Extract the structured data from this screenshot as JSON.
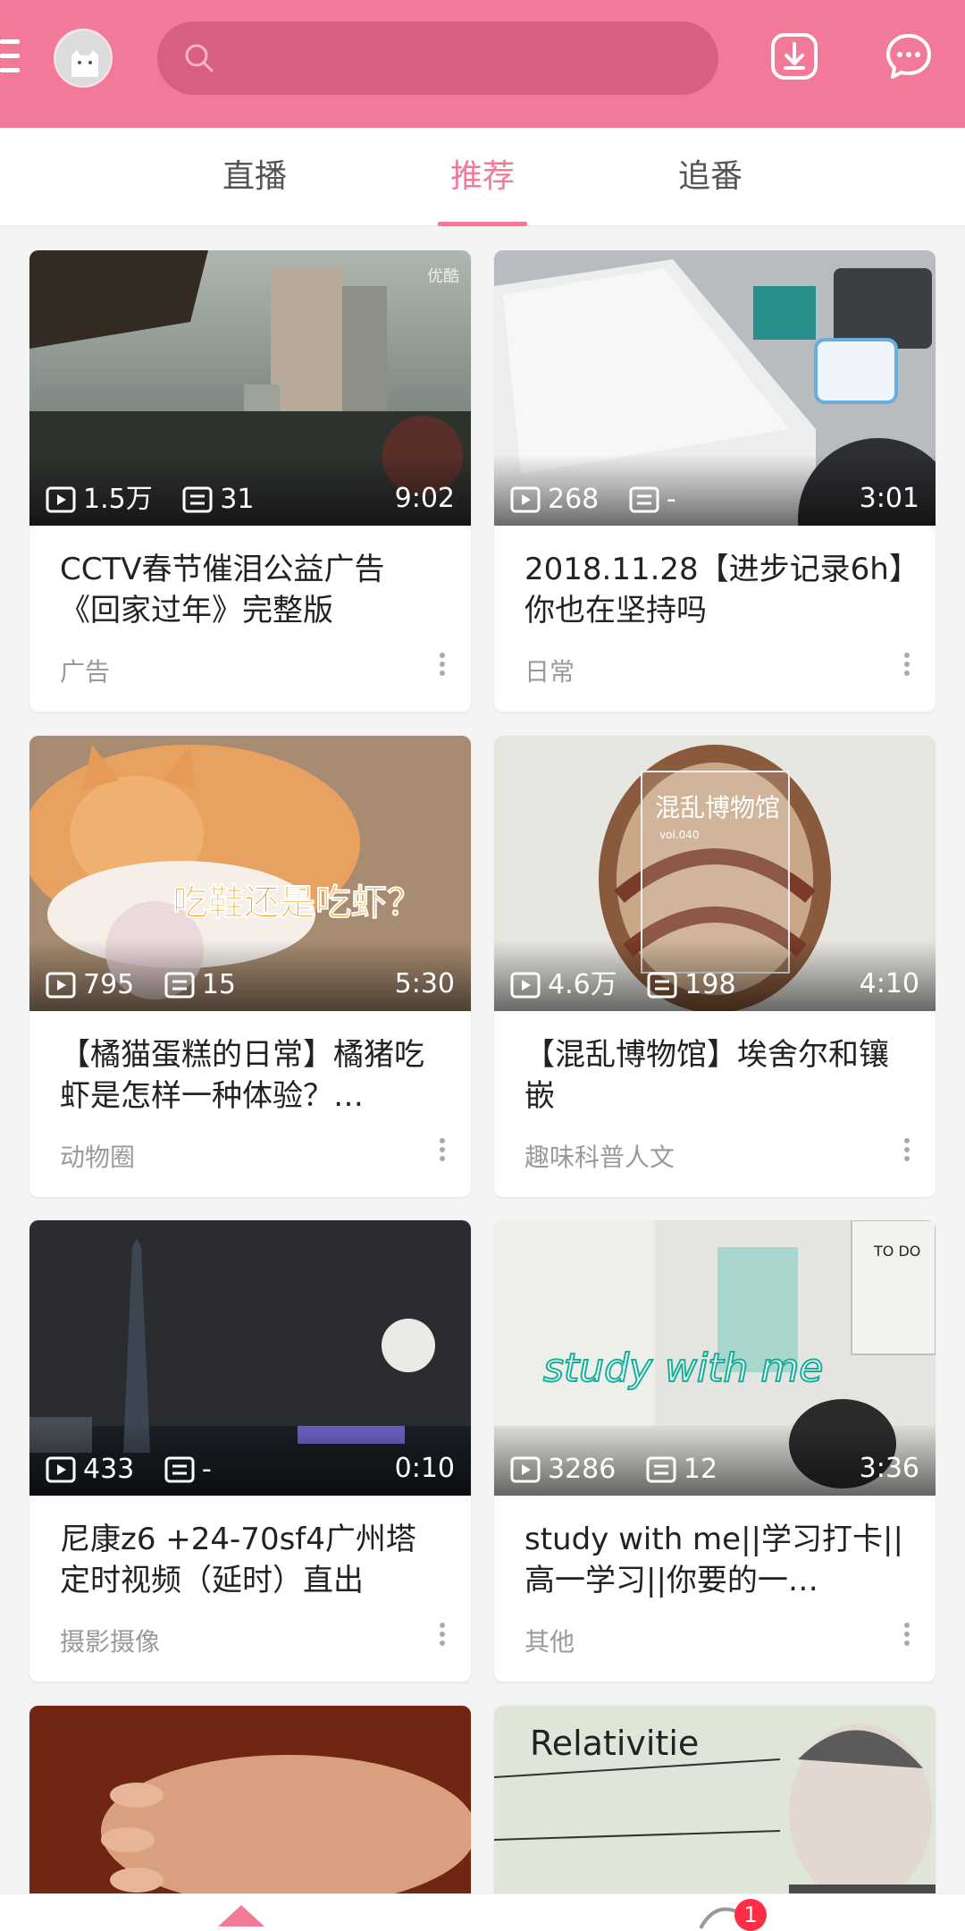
{
  "header": {
    "search_placeholder": "",
    "accent_color": "#f27a98",
    "icons": [
      "menu-icon",
      "avatar",
      "search-icon",
      "download-icon",
      "message-icon"
    ]
  },
  "tabs": [
    {
      "label": "直播",
      "active": false
    },
    {
      "label": "推荐",
      "active": true
    },
    {
      "label": "追番",
      "active": false
    }
  ],
  "cards": [
    {
      "views": "1.5万",
      "danmaku": "31",
      "duration": "9:02",
      "title": "CCTV春节催泪公益广告《回家过年》完整版",
      "category": "广告",
      "watermark": "优酷"
    },
    {
      "views": "268",
      "danmaku": "-",
      "duration": "3:01",
      "title": "2018.11.28【进步记录6h】你也在坚持吗",
      "category": "日常"
    },
    {
      "views": "795",
      "danmaku": "15",
      "duration": "5:30",
      "title": "【橘猫蛋糕的日常】橘猪吃虾是怎样一种体验？…",
      "category": "动物圈",
      "overlay_text": "吃鞋还是吃虾？"
    },
    {
      "views": "4.6万",
      "danmaku": "198",
      "duration": "4:10",
      "title": "【混乱博物馆】埃舍尔和镶嵌",
      "category": "趣味科普人文",
      "overlay_text": "混乱博物馆",
      "overlay_sub": "vol.040"
    },
    {
      "views": "433",
      "danmaku": "-",
      "duration": "0:10",
      "title": "尼康z6 +24-70sf4广州塔定时视频（延时）直出",
      "category": "摄影摄像"
    },
    {
      "views": "3286",
      "danmaku": "12",
      "duration": "3:36",
      "title": "study with me||学习打卡||高一学习||你要的一…",
      "category": "其他",
      "overlay_text": "study with me",
      "overlay_sub": "TO DO"
    },
    {
      "title": ""
    },
    {
      "title": "",
      "overlay_text": "Relativitie"
    }
  ],
  "bottom_nav": {
    "badge_count": "1"
  }
}
